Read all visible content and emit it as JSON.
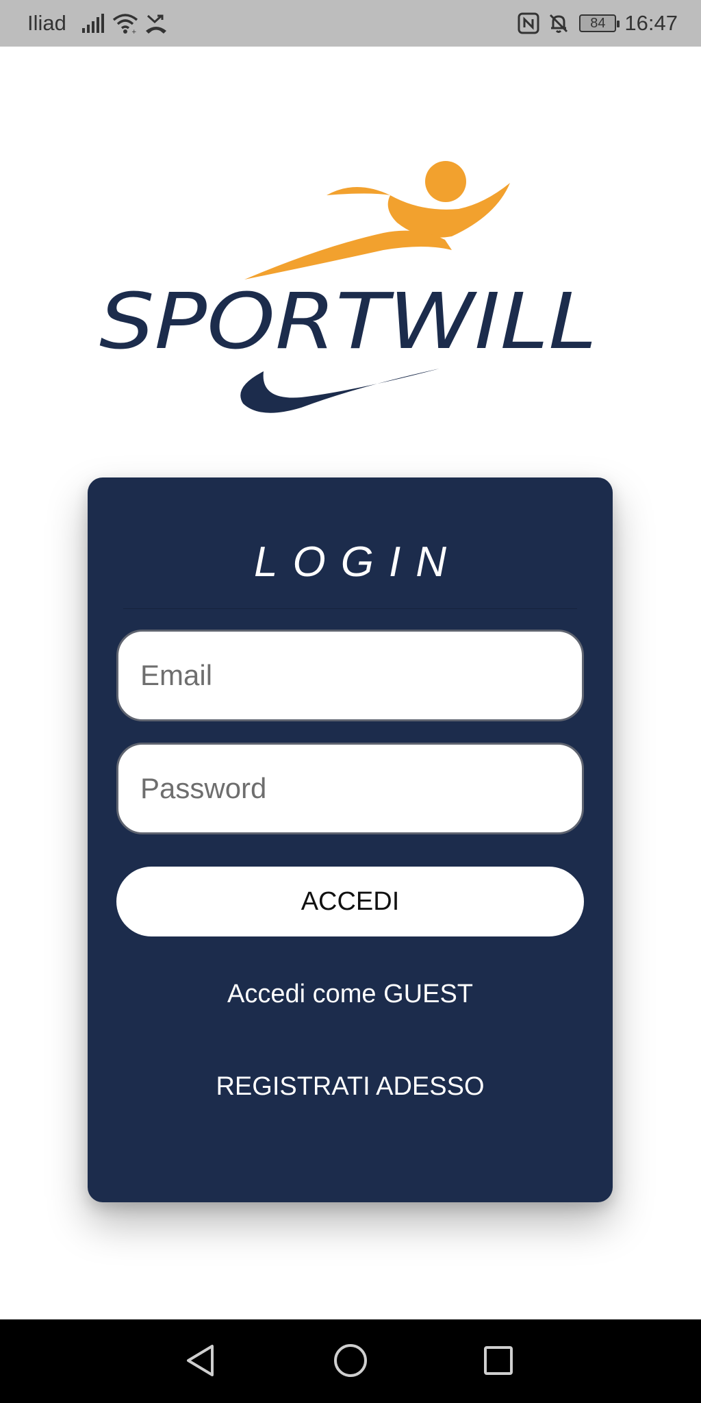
{
  "status_bar": {
    "carrier": "Iliad",
    "battery_level": "84",
    "time": "16:47",
    "icons": [
      "signal-icon",
      "wifi-icon",
      "missed-call-icon",
      "nfc-icon",
      "bell-off-icon",
      "battery-icon"
    ]
  },
  "logo": {
    "brand_name": "SPORTWILL",
    "colors": {
      "navy": "#1c2c4c",
      "orange": "#f2a12e"
    }
  },
  "login": {
    "title": "LOGIN",
    "email_placeholder": "Email",
    "password_placeholder": "Password",
    "submit_label": "ACCEDI",
    "guest_link": "Accedi come GUEST",
    "register_link": "REGISTRATI ADESSO"
  },
  "nav_bar": {
    "buttons": [
      "back-icon",
      "home-icon",
      "recent-apps-icon"
    ]
  },
  "colors": {
    "card_background": "#1c2c4c",
    "status_bar": "#bdbdbd",
    "nav_bar": "#000000"
  }
}
